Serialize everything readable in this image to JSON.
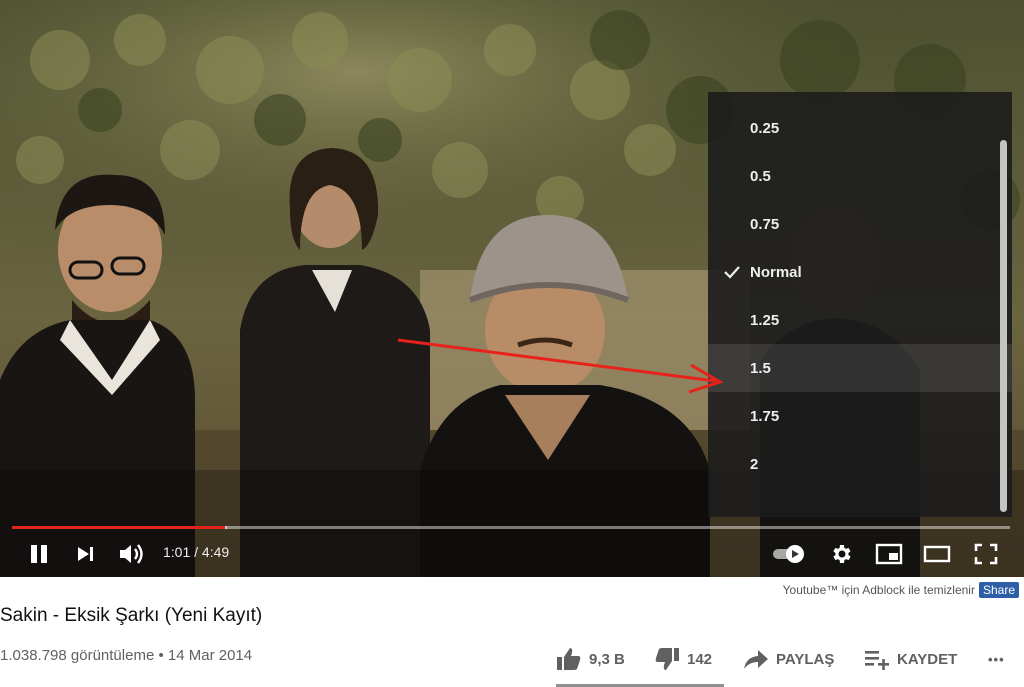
{
  "player": {
    "speed_menu": {
      "items": [
        "0.25",
        "0.5",
        "0.75",
        "Normal",
        "1.25",
        "1.5",
        "1.75",
        "2"
      ],
      "selected": "Normal",
      "hovered": "1.5"
    },
    "progress": {
      "played_fraction": 0.213,
      "loaded_fraction": 0.215
    },
    "time": {
      "current": "1:01",
      "separator": " / ",
      "duration": "4:49"
    },
    "colors": {
      "progress_played": "#e1251b",
      "menu_bg": "#1c1c1c",
      "arrow": "#e8221b"
    },
    "icons": [
      "pause-icon",
      "next-icon",
      "volume-icon",
      "autoplay-toggle-icon",
      "settings-icon",
      "miniplayer-icon",
      "theater-icon",
      "fullscreen-icon"
    ]
  },
  "adblock": {
    "text": "Youtube™ için Adblock ile temizlenir",
    "share_label": "Share"
  },
  "video": {
    "title": "Sakin - Eksik Şarkı (Yeni Kayıt)",
    "views": "1.038.798 görüntüleme",
    "bullet": " • ",
    "date": "14 Mar 2014"
  },
  "actions": {
    "like_count": "9,3 B",
    "dislike_count": "142",
    "share_label": "PAYLAŞ",
    "save_label": "KAYDET",
    "more_label": "•••"
  }
}
